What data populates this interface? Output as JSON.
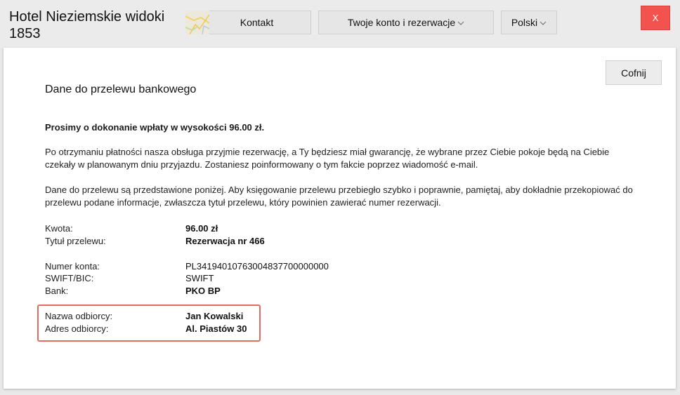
{
  "header": {
    "hotel_name": "Hotel Nieziemskie widoki 1853",
    "nav": {
      "contact_label": "Kontakt",
      "account_label": "Twoje konto i rezerwacje",
      "language_label": "Polski"
    },
    "close_label": "X"
  },
  "panel": {
    "back_label": "Cofnij",
    "title": "Dane do przelewu bankowego",
    "amount_request": "Prosimy o dokonanie wpłaty w wysokości 96.00 zł.",
    "paragraph1": "Po otrzymaniu płatności nasza obsługa przyjmie rezerwację, a Ty będziesz miał gwarancję, że wybrane przez Ciebie pokoje będą na Ciebie czekały w planowanym dniu przyjazdu. Zostaniesz poinformowany o tym fakcie poprzez wiadomość e-mail.",
    "paragraph2": "Dane do przelewu są przedstawione poniżej. Aby księgowanie przelewu przebiegło szybko i poprawnie, pamiętaj, aby dokładnie przekopiować do przelewu podane informacje, zwłaszcza tytuł przelewu, który powinien zawierać numer rezerwacji.",
    "details": {
      "amount_label": "Kwota:",
      "amount_value": "96.00 zł",
      "title_label": "Tytuł przelewu:",
      "title_value": "Rezerwacja nr 466",
      "account_label": "Numer konta:",
      "account_value": "PL34194010763004837700000000",
      "swift_label": "SWIFT/BIC:",
      "swift_value": "SWIFT",
      "bank_label": "Bank:",
      "bank_value": "PKO BP",
      "recipient_label": "Nazwa odbiorcy:",
      "recipient_value": "Jan Kowalski",
      "address_label": "Adres odbiorcy:",
      "address_value": "Al. Piastów 30"
    }
  },
  "colors": {
    "close_button": "#f3534f",
    "highlight_border": "#e56a5f"
  },
  "icons": {
    "map": "map-thumbnail-icon",
    "chevron": "chevron-down-icon",
    "close": "close-icon"
  }
}
